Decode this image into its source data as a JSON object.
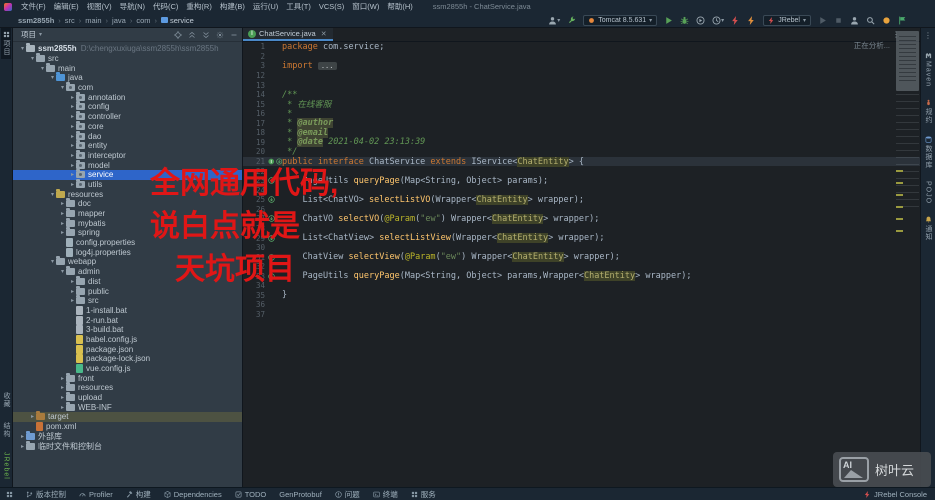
{
  "window": {
    "title": "ssm2855h - ChatService.java"
  },
  "menu": [
    "文件(F)",
    "编辑(E)",
    "视图(V)",
    "导航(N)",
    "代码(C)",
    "重构(R)",
    "构建(B)",
    "运行(U)",
    "工具(T)",
    "VCS(S)",
    "窗口(W)",
    "帮助(H)"
  ],
  "breadcrumb": [
    "ssm2855h",
    "src",
    "main",
    "java",
    "com",
    "service"
  ],
  "toolbar": {
    "items": [
      {
        "icon": "user-icon",
        "color": "#9aa7b0",
        "caret": true
      },
      {
        "icon": "wrench-icon",
        "color": "#67b35f"
      },
      {
        "combo": "Tomcat 8.5.631",
        "icon": "tomcat-icon",
        "color": "#e8883c"
      },
      {
        "icon": "run-icon",
        "color": "#58a158"
      },
      {
        "icon": "debug-icon",
        "color": "#58a158"
      },
      {
        "icon": "coverage-icon",
        "color": "#9aa7b0"
      },
      {
        "icon": "profiler-icon",
        "color": "#9aa7b0",
        "caret": true
      },
      {
        "icon": "bolt-icon",
        "color": "#d64f4f"
      },
      {
        "icon": "bolt-icon",
        "color": "#e08f3c"
      },
      {
        "combo": "JRebel",
        "icon": "bolt-icon",
        "color": "#d64f4f"
      },
      {
        "icon": "run-icon",
        "color": "#4f5b66"
      },
      {
        "icon": "stop-icon",
        "color": "#4f5b66"
      },
      {
        "icon": "user-icon",
        "color": "#9aa7b0"
      },
      {
        "icon": "magnifier-icon",
        "color": "#9aa7b0"
      },
      {
        "icon": "dot-icon",
        "color": "#e8a33d"
      },
      {
        "icon": "flag-icon",
        "color": "#4aa96c"
      }
    ]
  },
  "left_stripe": {
    "top": [
      {
        "label": "项目",
        "icon": "grid",
        "active": true
      }
    ],
    "bottom": [
      {
        "label": "收藏"
      },
      {
        "label": "结构"
      },
      {
        "label": "JRebel",
        "color": "#6ab04c"
      }
    ]
  },
  "right_stripe": [
    {
      "icon": "maven",
      "label": "Maven",
      "color": "#9aa7b0"
    },
    {
      "icon": "ant",
      "label": "规约",
      "color": "#c96a4a"
    },
    {
      "icon": "db",
      "label": "数据库",
      "color": "#6f9bd1"
    },
    {
      "icon": "",
      "label": "POJO",
      "color": "#9aa7b0"
    },
    {
      "icon": "bell",
      "label": "通知",
      "color": "#c7a44a"
    }
  ],
  "project_panel": {
    "title": "项目",
    "header_icons": [
      "locate",
      "collapse",
      "expand",
      "gear",
      "minus"
    ],
    "tree": [
      {
        "lv": 0,
        "ar": "v",
        "ic": "c-proj fol",
        "label": "ssm2855h",
        "sub": "D:\\chengxuxiuga\\ssm2855h\\ssm2855h",
        "bold": true
      },
      {
        "lv": 1,
        "ar": "v",
        "ic": "c-dir fol",
        "label": "src"
      },
      {
        "lv": 2,
        "ar": "v",
        "ic": "c-dir fol",
        "label": "main"
      },
      {
        "lv": 3,
        "ar": "v",
        "ic": "c-src fol",
        "label": "java"
      },
      {
        "lv": 4,
        "ar": "v",
        "ic": "c-pkg fol",
        "label": "com"
      },
      {
        "lv": 5,
        "ar": ">",
        "ic": "c-pkg fol",
        "label": "annotation"
      },
      {
        "lv": 5,
        "ar": ">",
        "ic": "c-pkg fol",
        "label": "config"
      },
      {
        "lv": 5,
        "ar": ">",
        "ic": "c-pkg fol",
        "label": "controller"
      },
      {
        "lv": 5,
        "ar": ">",
        "ic": "c-pkg fol",
        "label": "core"
      },
      {
        "lv": 5,
        "ar": ">",
        "ic": "c-pkg fol",
        "label": "dao"
      },
      {
        "lv": 5,
        "ar": ">",
        "ic": "c-pkg fol",
        "label": "entity"
      },
      {
        "lv": 5,
        "ar": ">",
        "ic": "c-pkg fol",
        "label": "interceptor"
      },
      {
        "lv": 5,
        "ar": ">",
        "ic": "c-pkg fol",
        "label": "model"
      },
      {
        "lv": 5,
        "ar": ">",
        "ic": "c-pkg fol",
        "label": "service",
        "selected": true
      },
      {
        "lv": 5,
        "ar": ">",
        "ic": "c-pkg fol",
        "label": "utils"
      },
      {
        "lv": 3,
        "ar": "v",
        "ic": "c-res fol",
        "label": "resources"
      },
      {
        "lv": 4,
        "ar": ">",
        "ic": "c-dir fol",
        "label": "doc"
      },
      {
        "lv": 4,
        "ar": ">",
        "ic": "c-dir fol",
        "label": "mapper"
      },
      {
        "lv": 4,
        "ar": ">",
        "ic": "c-dir fol",
        "label": "mybatis"
      },
      {
        "lv": 4,
        "ar": ">",
        "ic": "c-dir fol",
        "label": "spring"
      },
      {
        "lv": 4,
        "ar": "",
        "ic": "c-props file",
        "label": "config.properties"
      },
      {
        "lv": 4,
        "ar": "",
        "ic": "c-props file",
        "label": "log4j.properties"
      },
      {
        "lv": 3,
        "ar": "v",
        "ic": "c-dir fol",
        "label": "webapp"
      },
      {
        "lv": 4,
        "ar": "v",
        "ic": "c-dir fol",
        "label": "admin"
      },
      {
        "lv": 5,
        "ar": ">",
        "ic": "c-dir fol",
        "label": "dist"
      },
      {
        "lv": 5,
        "ar": ">",
        "ic": "c-dir fol",
        "label": "public"
      },
      {
        "lv": 5,
        "ar": ">",
        "ic": "c-dir fol",
        "label": "src"
      },
      {
        "lv": 5,
        "ar": "",
        "ic": "c-bat file",
        "label": "1-install.bat"
      },
      {
        "lv": 5,
        "ar": "",
        "ic": "c-bat file",
        "label": "2-run.bat"
      },
      {
        "lv": 5,
        "ar": "",
        "ic": "c-bat file",
        "label": "3-build.bat"
      },
      {
        "lv": 5,
        "ar": "",
        "ic": "c-js file",
        "label": "babel.config.js"
      },
      {
        "lv": 5,
        "ar": "",
        "ic": "c-json file",
        "label": "package.json"
      },
      {
        "lv": 5,
        "ar": "",
        "ic": "c-json file",
        "label": "package-lock.json"
      },
      {
        "lv": 5,
        "ar": "",
        "ic": "c-vue file",
        "label": "vue.config.js"
      },
      {
        "lv": 4,
        "ar": ">",
        "ic": "c-dir fol",
        "label": "front"
      },
      {
        "lv": 4,
        "ar": ">",
        "ic": "c-dir fol",
        "label": "resources"
      },
      {
        "lv": 4,
        "ar": ">",
        "ic": "c-dir fol",
        "label": "upload"
      },
      {
        "lv": 4,
        "ar": ">",
        "ic": "c-dir fol",
        "label": "WEB-INF"
      },
      {
        "lv": 1,
        "ar": ">",
        "ic": "c-excl fol",
        "label": "target",
        "olive": true
      },
      {
        "lv": 1,
        "ar": "",
        "ic": "c-pom file",
        "label": "pom.xml"
      },
      {
        "lv": 0,
        "ar": ">",
        "ic": "c-lib fol",
        "label": "外部库"
      },
      {
        "lv": 0,
        "ar": ">",
        "ic": "c-scr fol",
        "label": "临时文件和控制台"
      }
    ]
  },
  "editor": {
    "tab": "ChatService.java",
    "analyzing": "正在分析...",
    "lines": [
      {
        "n": 1,
        "t": [
          [
            "k",
            "package"
          ],
          [
            "d",
            " com.service;"
          ]
        ]
      },
      {
        "n": 2,
        "t": []
      },
      {
        "n": 3,
        "t": [
          [
            "k",
            "import"
          ],
          [
            "d",
            " "
          ],
          [
            "fold",
            "..."
          ]
        ]
      },
      {
        "n": 12,
        "t": []
      },
      {
        "n": 13,
        "t": []
      },
      {
        "n": 14,
        "t": [
          [
            "c",
            "/**"
          ]
        ]
      },
      {
        "n": 15,
        "t": [
          [
            "c",
            " * 在线客服"
          ]
        ]
      },
      {
        "n": 16,
        "t": [
          [
            "c",
            " *"
          ]
        ]
      },
      {
        "n": 17,
        "t": [
          [
            "c",
            " * "
          ],
          [
            "ct",
            "@author"
          ]
        ]
      },
      {
        "n": 18,
        "t": [
          [
            "c",
            " * "
          ],
          [
            "ct",
            "@email"
          ]
        ]
      },
      {
        "n": 19,
        "t": [
          [
            "c",
            " * "
          ],
          [
            "ct",
            "@date"
          ],
          [
            "c",
            " 2021-04-02 23:13:39"
          ]
        ]
      },
      {
        "n": 20,
        "t": [
          [
            "c",
            " */"
          ]
        ]
      },
      {
        "n": 21,
        "caret": true,
        "g": "iface",
        "t": [
          [
            "k",
            "public interface"
          ],
          [
            "d",
            " ChatService "
          ],
          [
            "k",
            "extends"
          ],
          [
            "d",
            " IService<"
          ],
          [
            "hl",
            "ChatEntity"
          ],
          [
            "d",
            "> {"
          ]
        ]
      },
      {
        "n": 22,
        "t": []
      },
      {
        "n": 23,
        "g": "impl",
        "t": [
          [
            "d",
            "    PageUtils "
          ],
          [
            "m",
            "queryPage"
          ],
          [
            "d",
            "(Map<String, Object> params);"
          ]
        ]
      },
      {
        "n": 24,
        "t": []
      },
      {
        "n": 25,
        "g": "impl",
        "t": [
          [
            "d",
            "    List<ChatVO> "
          ],
          [
            "m",
            "selectListVO"
          ],
          [
            "d",
            "(Wrapper<"
          ],
          [
            "hl",
            "ChatEntity"
          ],
          [
            "d",
            "> wrapper);"
          ]
        ]
      },
      {
        "n": 26,
        "t": []
      },
      {
        "n": 27,
        "g": "impl",
        "t": [
          [
            "d",
            "    ChatVO "
          ],
          [
            "m",
            "selectVO"
          ],
          [
            "d",
            "("
          ],
          [
            "a",
            "@Param"
          ],
          [
            "d",
            "("
          ],
          [
            "s",
            "\"ew\""
          ],
          [
            "d",
            ") Wrapper<"
          ],
          [
            "hl",
            "ChatEntity"
          ],
          [
            "d",
            "> wrapper);"
          ]
        ]
      },
      {
        "n": 28,
        "t": []
      },
      {
        "n": 29,
        "g": "impl",
        "t": [
          [
            "d",
            "    List<ChatView> "
          ],
          [
            "m",
            "selectListView"
          ],
          [
            "d",
            "(Wrapper<"
          ],
          [
            "hl",
            "ChatEntity"
          ],
          [
            "d",
            "> wrapper);"
          ]
        ]
      },
      {
        "n": 30,
        "t": []
      },
      {
        "n": 31,
        "g": "impl",
        "t": [
          [
            "d",
            "    ChatView "
          ],
          [
            "m",
            "selectView"
          ],
          [
            "d",
            "("
          ],
          [
            "a",
            "@Param"
          ],
          [
            "d",
            "("
          ],
          [
            "s",
            "\"ew\""
          ],
          [
            "d",
            ") Wrapper<"
          ],
          [
            "hl",
            "ChatEntity"
          ],
          [
            "d",
            "> wrapper);"
          ]
        ]
      },
      {
        "n": 32,
        "t": []
      },
      {
        "n": 33,
        "g": "impl",
        "t": [
          [
            "d",
            "    PageUtils "
          ],
          [
            "m",
            "queryPage"
          ],
          [
            "d",
            "(Map<String, Object> params,Wrapper<"
          ],
          [
            "hl",
            "ChatEntity"
          ],
          [
            "d",
            "> wrapper);"
          ]
        ]
      },
      {
        "n": 34,
        "t": []
      },
      {
        "n": 35,
        "t": [
          [
            "d",
            "}"
          ]
        ]
      },
      {
        "n": 36,
        "t": []
      },
      {
        "n": 37,
        "t": []
      }
    ]
  },
  "status_bar": {
    "left": [
      {
        "icon": "branch",
        "label": "版本控制"
      },
      {
        "icon": "gauge",
        "label": "Profiler"
      },
      {
        "icon": "hammer",
        "label": "构建"
      },
      {
        "icon": "box",
        "label": "Dependencies"
      },
      {
        "icon": "todo",
        "label": "TODO"
      },
      {
        "icon": "",
        "label": "GenProtobuf"
      },
      {
        "icon": "problem",
        "label": "问题"
      },
      {
        "icon": "terminal",
        "label": "终端"
      },
      {
        "icon": "services",
        "label": "服务"
      }
    ],
    "right": {
      "icon": "bolt",
      "label": "JRebel Console",
      "color": "#d64f4f"
    }
  },
  "overlay": {
    "lines": [
      "全网通用代码,",
      "说白点就是",
      "天坑项目"
    ],
    "color": "#e01616"
  },
  "watermark": {
    "logo": "AI",
    "label": "树叶云"
  }
}
